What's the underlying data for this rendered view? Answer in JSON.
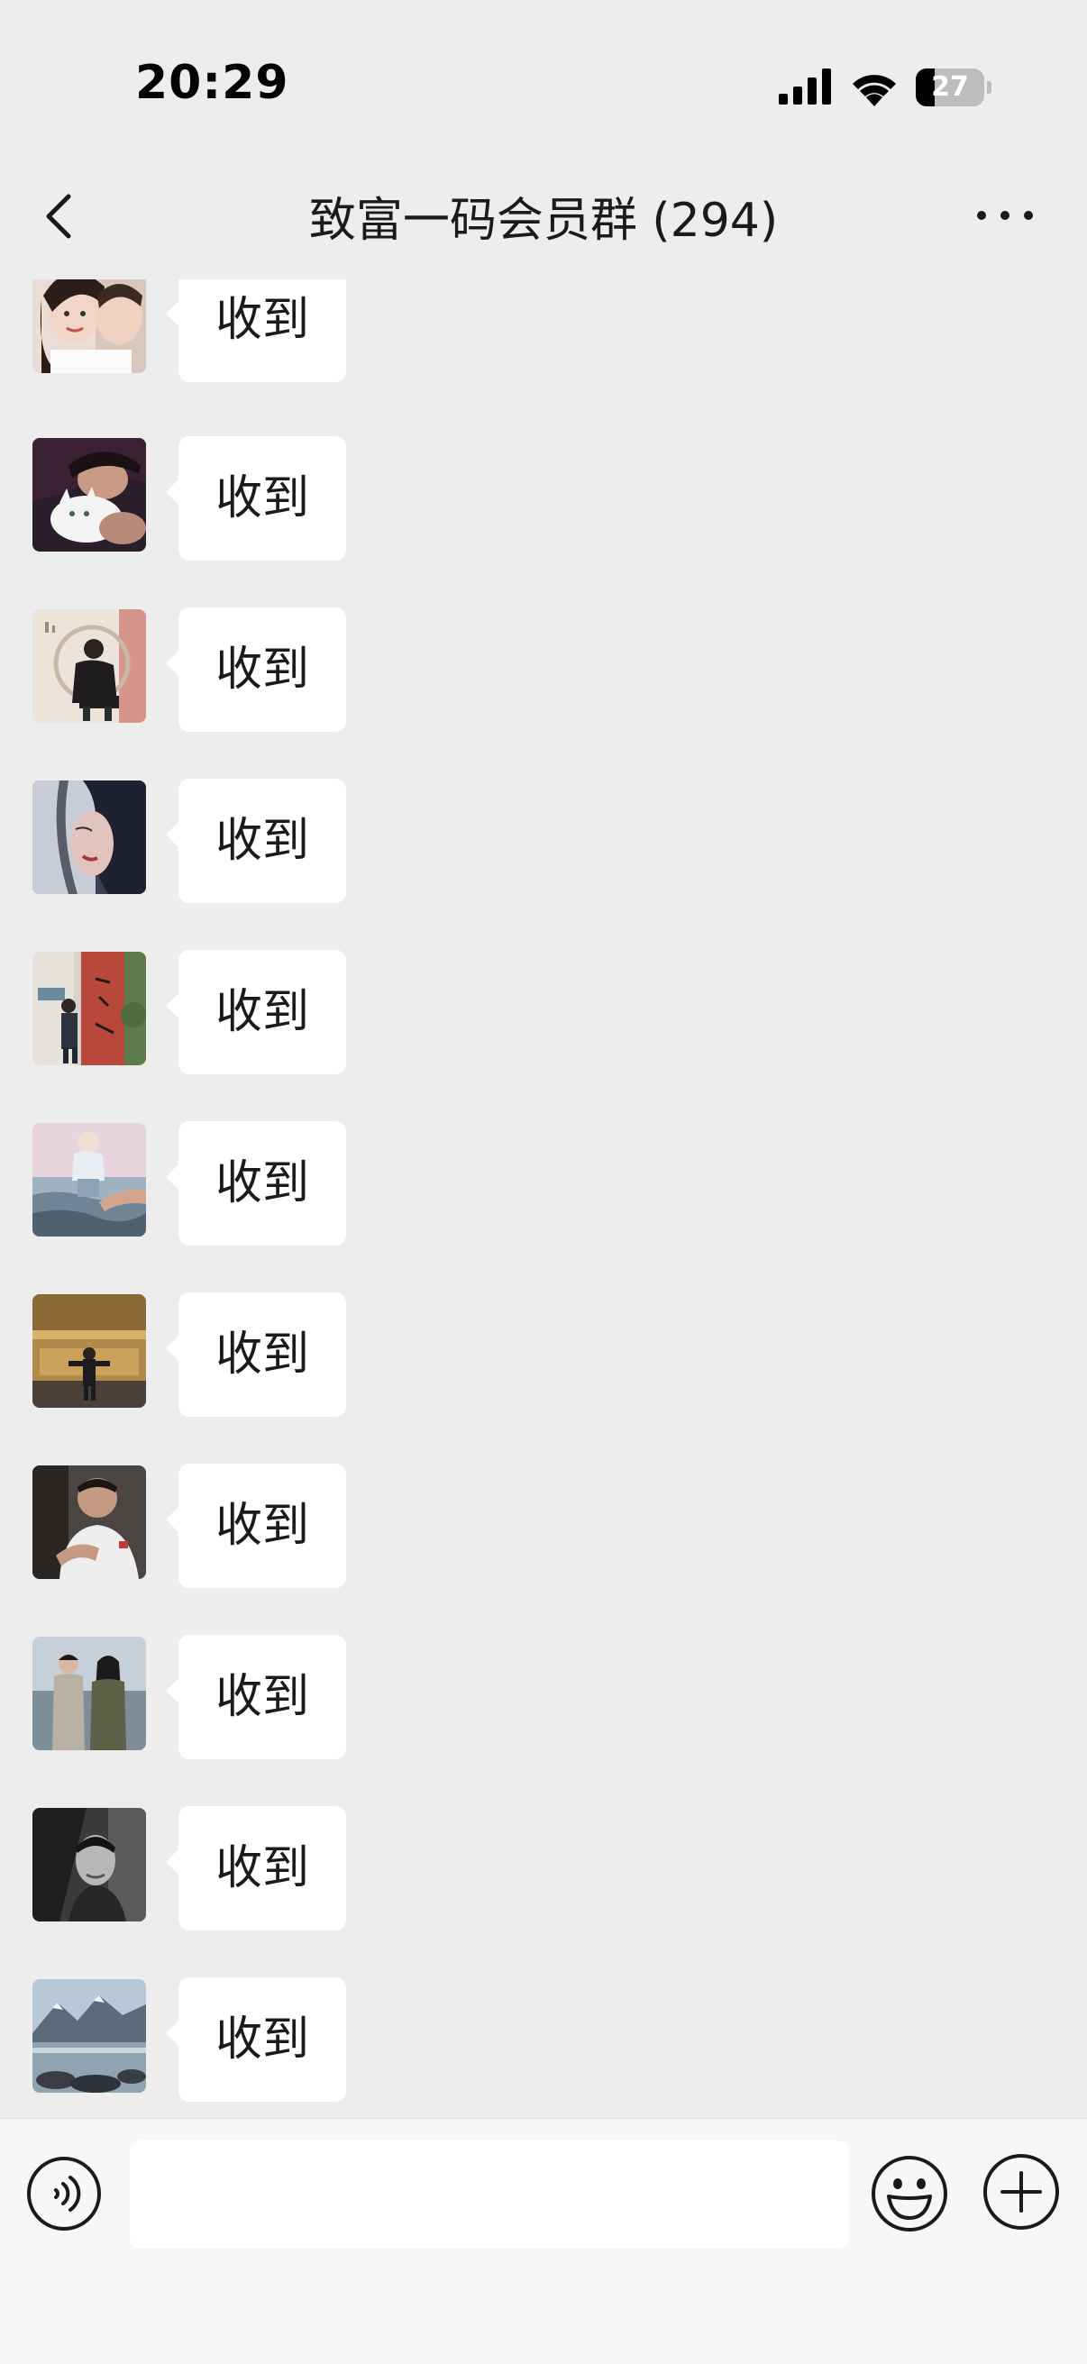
{
  "status_bar": {
    "time": "20:29",
    "battery_level": "27",
    "battery_fraction": 0.27
  },
  "nav": {
    "title": "致富一码会员群 (294)",
    "back_icon": "chevron-left-icon",
    "more_icon": "more-dots-icon"
  },
  "messages": [
    {
      "text": "收到",
      "avatar": "avatar-couple-selfie"
    },
    {
      "text": "收到",
      "avatar": "avatar-woman-with-white-cat"
    },
    {
      "text": "收到",
      "avatar": "avatar-man-in-round-chair"
    },
    {
      "text": "收到",
      "avatar": "avatar-woman-closeup"
    },
    {
      "text": "收到",
      "avatar": "avatar-street-with-red-banner"
    },
    {
      "text": "收到",
      "avatar": "avatar-baby-over-sea"
    },
    {
      "text": "收到",
      "avatar": "avatar-man-before-golden-wall"
    },
    {
      "text": "收到",
      "avatar": "avatar-man-in-white-tshirt"
    },
    {
      "text": "收到",
      "avatar": "avatar-couple-by-lake"
    },
    {
      "text": "收到",
      "avatar": "avatar-man-in-car-bw"
    },
    {
      "text": "收到",
      "avatar": "avatar-mountain-lake"
    }
  ],
  "input_bar": {
    "placeholder": "",
    "value": "",
    "voice_icon": "voice-icon",
    "emoji_icon": "emoji-icon",
    "plus_icon": "plus-icon"
  },
  "colors": {
    "background": "#ededed",
    "bubble": "#ffffff",
    "input_bar": "#f7f7f7"
  }
}
